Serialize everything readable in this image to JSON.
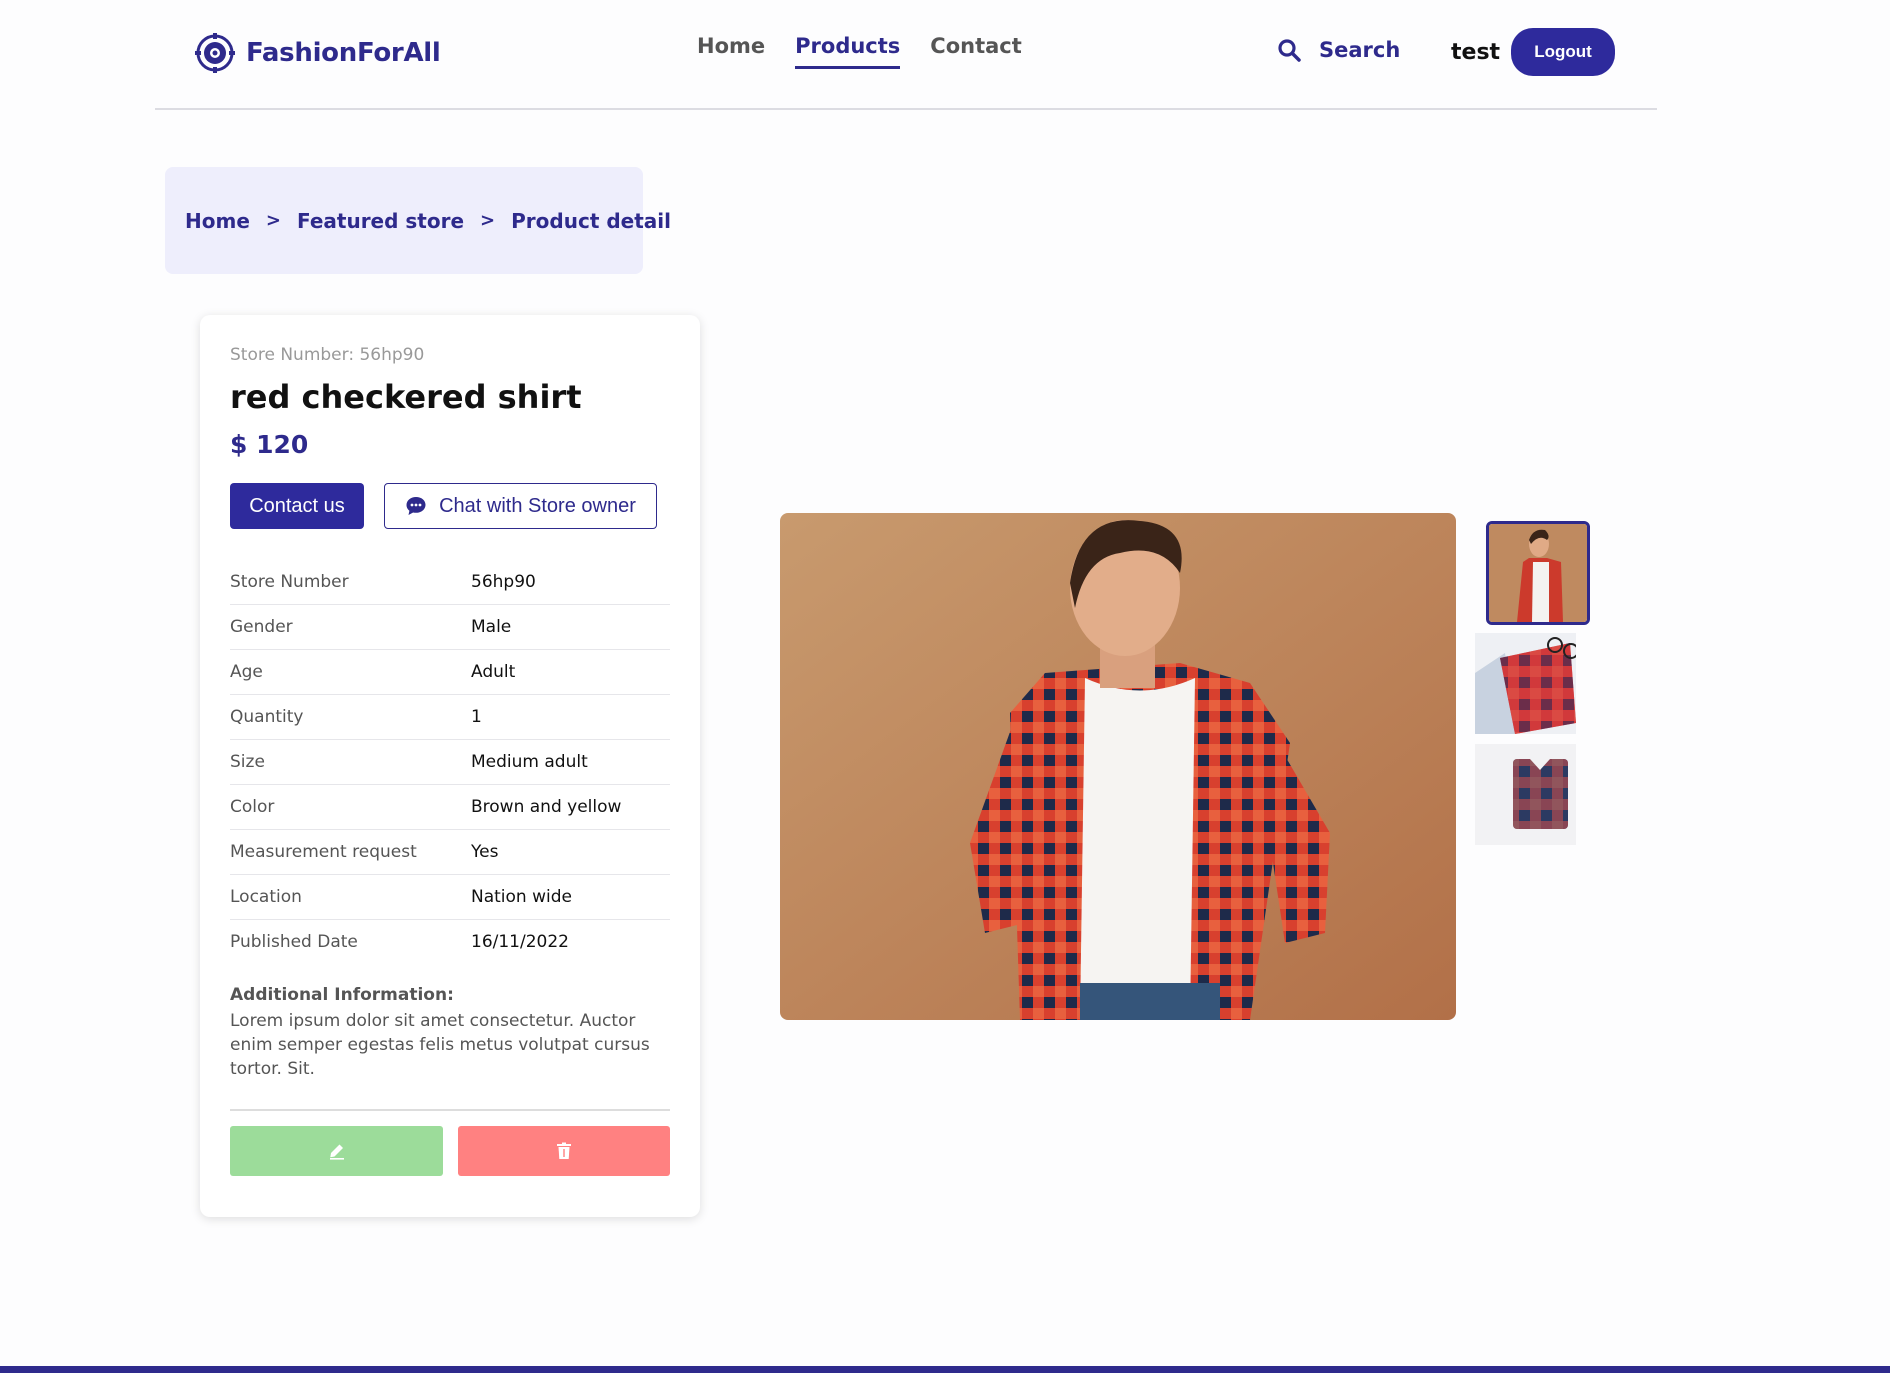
{
  "brand": {
    "name": "FashionForAll",
    "color": "#2e2a8c",
    "logo_icon": "target-logo-icon"
  },
  "nav": {
    "items": [
      {
        "label": "Home",
        "active": false
      },
      {
        "label": "Products",
        "active": true
      },
      {
        "label": "Contact",
        "active": false
      }
    ]
  },
  "header": {
    "search_icon": "search-icon",
    "search_label": "Search",
    "username": "test",
    "logout_label": "Logout"
  },
  "breadcrumb": {
    "items": [
      "Home",
      "Featured store",
      "Product detail"
    ],
    "separator": ">"
  },
  "product": {
    "store_number_line": "Store Number: 56hp90",
    "title": "red checkered shirt",
    "price": "$ 120",
    "contact_label": "Contact us",
    "chat_label": "Chat with Store owner",
    "chat_icon": "chat-bubble-icon",
    "details": [
      {
        "label": "Store Number",
        "value": "56hp90"
      },
      {
        "label": "Gender",
        "value": "Male"
      },
      {
        "label": "Age",
        "value": "Adult"
      },
      {
        "label": "Quantity",
        "value": "1"
      },
      {
        "label": "Size",
        "value": "Medium adult"
      },
      {
        "label": "Color",
        "value": "Brown and yellow"
      },
      {
        "label": "Measurement request",
        "value": "Yes"
      },
      {
        "label": "Location",
        "value": "Nation wide"
      },
      {
        "label": "Published Date",
        "value": "16/11/2022"
      }
    ],
    "additional_info_heading": "Additional Information:",
    "additional_info": "Lorem ipsum dolor sit amet consectetur. Auctor enim semper egestas felis metus volutpat cursus tortor. Sit.",
    "edit_icon": "pencil-icon",
    "delete_icon": "trash-icon",
    "colors": {
      "edit": "#9cdc9a",
      "delete": "#ff8181",
      "accent": "#2e2a9c"
    }
  },
  "gallery": {
    "main_image": "man-in-red-checkered-shirt-photo",
    "thumbnails": [
      "man-in-red-checkered-shirt-thumb",
      "folded-checkered-shirt-with-glasses-thumb",
      "folded-blue-checkered-shirt-thumb"
    ],
    "selected_index": 0
  }
}
